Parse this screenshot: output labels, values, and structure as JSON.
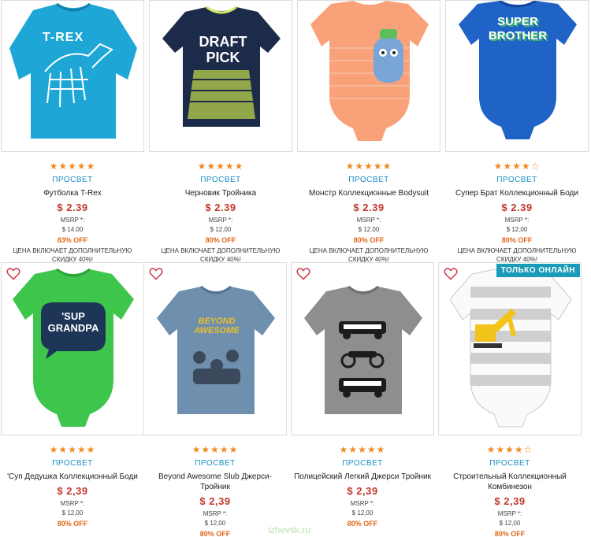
{
  "accent_color": "#1a8fc7",
  "price_color": "#c0392b",
  "off_color": "#e0671a",
  "star_color": "#f08a24",
  "watermark": "izhevsk.ru",
  "rows": [
    {
      "products": [
        {
          "stars": "★★★★★",
          "brand": "ПРОСВЕТ",
          "name": "Футболка T-Rex",
          "price": "$ 2.39",
          "msrp_label": "MSRP *:",
          "msrp_value": "$ 14.00",
          "off": "83% OFF",
          "note": "ЦЕНА ВКЛЮЧАЕТ ДОПОЛНИТЕЛЬНУЮ СКИДКУ 40%!",
          "graphic_text": "T-REX",
          "shirt_color": "#1ea7d6"
        },
        {
          "stars": "★★★★★",
          "brand": "ПРОСВЕТ",
          "name": "Черновик Тройника",
          "price": "$ 2.39",
          "msrp_label": "MSRP *:",
          "msrp_value": "$ 12.00",
          "off": "80% OFF",
          "note": "ЦЕНА ВКЛЮЧАЕТ ДОПОЛНИТЕЛЬНУЮ СКИДКУ 40%!",
          "graphic_text": "DRAFT PICK",
          "shirt_color": "#1d2b4a"
        },
        {
          "stars": "★★★★★",
          "brand": "ПРОСВЕТ",
          "name": "Монстр Коллекционные Bodysuit",
          "price": "$ 2.39",
          "msrp_label": "MSRP *:",
          "msrp_value": "$ 12.00",
          "off": "80% OFF",
          "note": "ЦЕНА ВКЛЮЧАЕТ ДОПОЛНИТЕЛЬНУЮ СКИДКУ 40%!",
          "graphic_text": "",
          "shirt_color": "#f9a27a"
        },
        {
          "stars": "★★★★☆",
          "brand": "ПРОСВЕТ",
          "name": "Супер Брат Коллекционный Боди",
          "price": "$ 2.39",
          "msrp_label": "MSRP *:",
          "msrp_value": "$ 12.00",
          "off": "80% OFF",
          "note": "ЦЕНА ВКЛЮЧАЕТ ДОПОЛНИТЕЛЬНУЮ СКИДКУ 40%!",
          "graphic_text": "SUPER BROTHER",
          "shirt_color": "#1f63c6"
        }
      ]
    },
    {
      "products": [
        {
          "stars": "★★★★★",
          "brand": "ПРОСВЕТ",
          "name": "'Суп Дедушка Коллекционный Боди",
          "price": "$ 2,39",
          "msrp_label": "MSRP *:",
          "msrp_value": "$ 12,00",
          "off": "80% OFF",
          "graphic_text": "'SUP GRANDPA",
          "shirt_color": "#3ec64c"
        },
        {
          "stars": "★★★★★",
          "brand": "ПРОСВЕТ",
          "name": "Beyond Awesome Slub Джерси-Тройник",
          "price": "$ 2,39",
          "msrp_label": "MSRP *:",
          "msrp_value": "$ 12,00",
          "off": "80% OFF",
          "graphic_text": "BEYOND AWESOME",
          "shirt_color": "#6f8fae"
        },
        {
          "stars": "★★★★★",
          "brand": "ПРОСВЕТ",
          "name": "Полицейский Легкий Джерси Тройник",
          "price": "$ 2,39",
          "msrp_label": "MSRP *:",
          "msrp_value": "$ 12,00",
          "off": "80% OFF",
          "graphic_text": "",
          "shirt_color": "#8e8e8e"
        },
        {
          "stars": "★★★★☆",
          "brand": "ПРОСВЕТ",
          "name": "Строительный Коллекционный Комбинезон",
          "price": "$ 2,39",
          "msrp_label": "MSRP *:",
          "msrp_value": "$ 12,00",
          "off": "80% OFF",
          "badge": "ТОЛЬКО ОНЛАЙН",
          "graphic_text": "",
          "shirt_color": "#d9d9d9"
        }
      ]
    }
  ]
}
